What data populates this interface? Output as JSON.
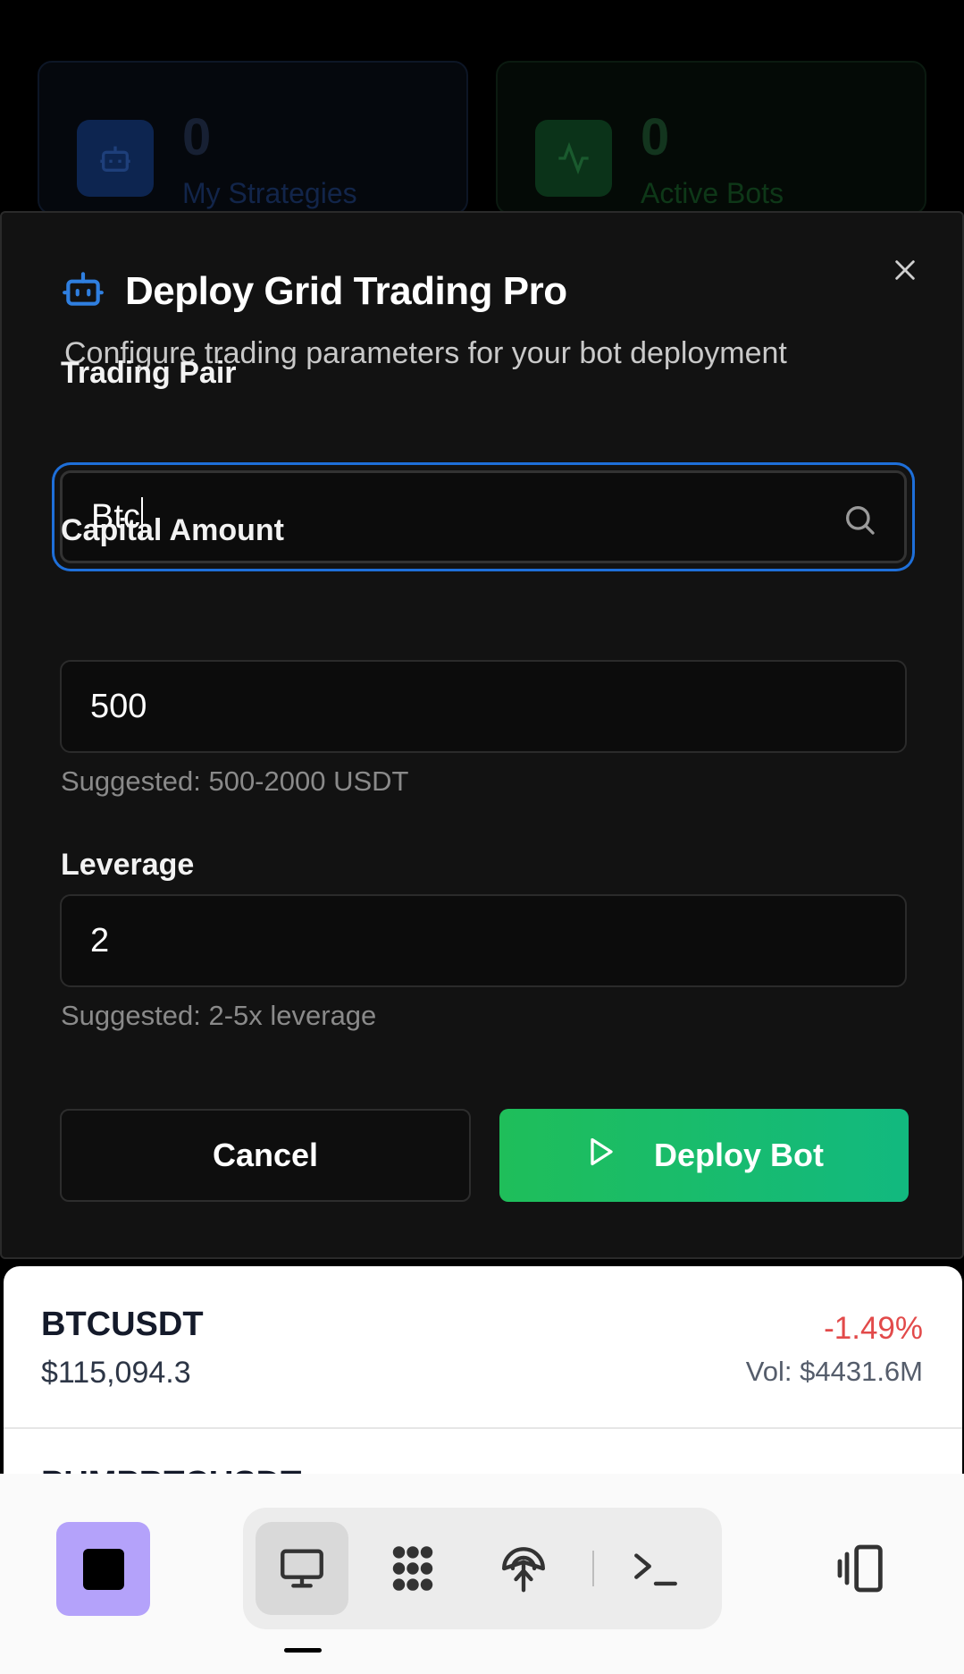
{
  "stats": [
    {
      "value": "0",
      "label": "My Strategies",
      "icon": "robot-icon"
    },
    {
      "value": "0",
      "label": "Active Bots",
      "icon": "activity-icon"
    }
  ],
  "modal": {
    "title": "Deploy Grid Trading Pro",
    "subtitle": "Configure trading parameters for your bot deployment",
    "icon": "robot-icon",
    "fields": {
      "pair": {
        "label": "Trading Pair",
        "value": "Btc"
      },
      "capital": {
        "label": "Capital Amount",
        "value": "500",
        "hint": "Suggested: 500-2000 USDT"
      },
      "leverage": {
        "label": "Leverage",
        "value": "2",
        "hint": "Suggested: 2-5x leverage"
      }
    },
    "cancel_label": "Cancel",
    "deploy_label": "Deploy Bot"
  },
  "ticker": {
    "symbol": "BTCUSDT",
    "price": "$115,094.3",
    "change": "-1.49%",
    "volume": "Vol: $4431.6M",
    "next_symbol": "PUMPBTCUSDT"
  },
  "colors": {
    "accent_blue": "#2f7fe0",
    "deploy_green": "#1fbe5a",
    "negative_red": "#e24a4a",
    "stop_purple": "#b4a2fa"
  },
  "toolbar": {
    "tools": [
      "desktop-icon",
      "apps-icon",
      "share-icon",
      "terminal-icon"
    ],
    "stop": "stop-icon",
    "side": "side-panel-icon"
  }
}
